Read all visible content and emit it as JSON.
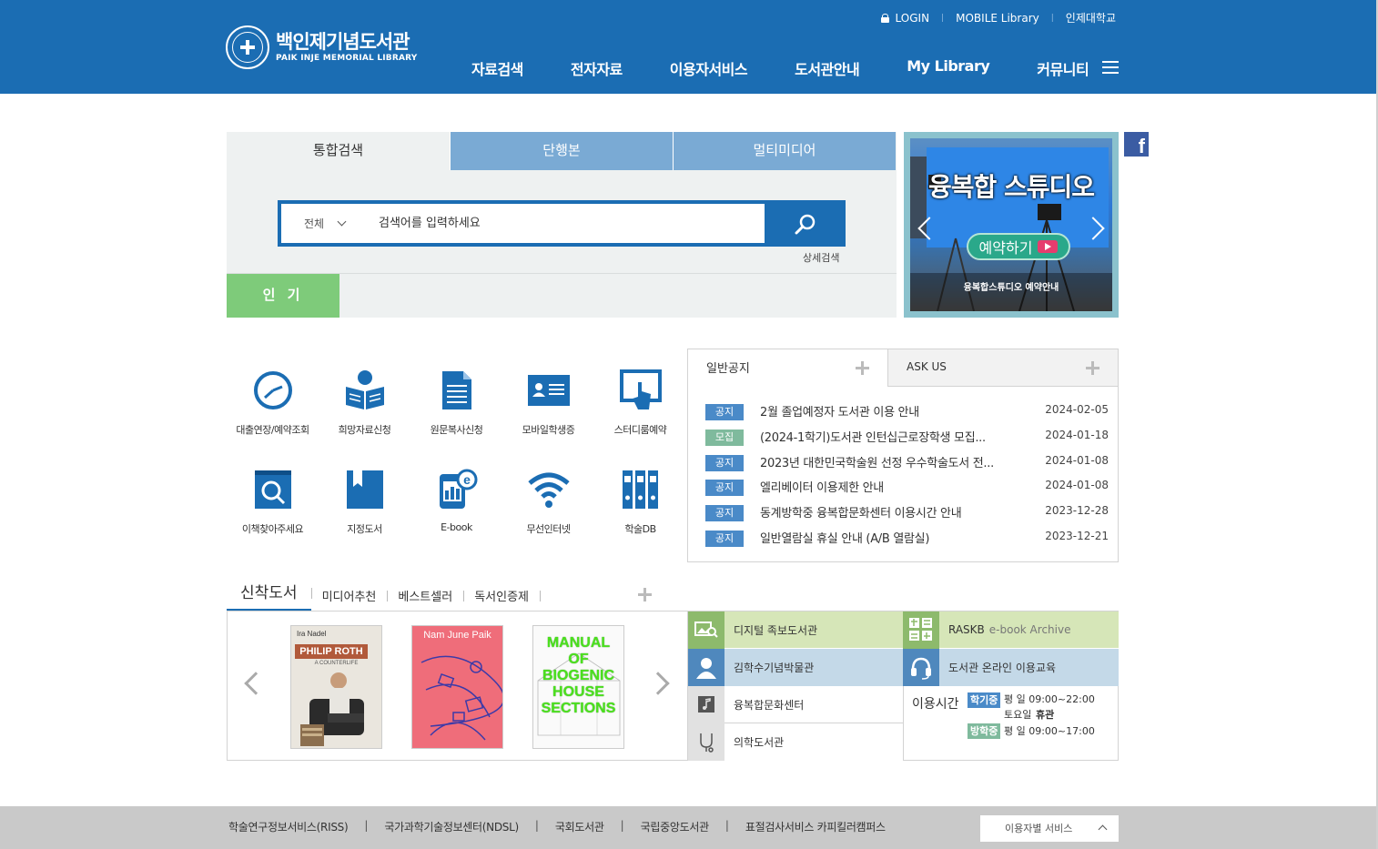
{
  "header": {
    "logo_ko": "백인제기념도서관",
    "logo_en": "PAIK INJE MEMORIAL LIBRARY",
    "util": {
      "login": "LOGIN",
      "mobile": "MOBILE Library",
      "univ": "인제대학교"
    },
    "nav": [
      "자료검색",
      "전자자료",
      "이용자서비스",
      "도서관안내",
      "My Library",
      "커뮤니티"
    ]
  },
  "search": {
    "tabs": [
      "통합검색",
      "단행본",
      "멀티미디어"
    ],
    "scope": "전체",
    "placeholder": "검색어를 입력하세요",
    "advanced": "상세검색",
    "popular": "인 기"
  },
  "banner": {
    "title": "융복합 스튜디오",
    "reserve": "예약하기",
    "caption": "융복합스튜디오 예약안내"
  },
  "quick_menu": [
    {
      "label": "대출연장/예약조회",
      "icon": "clock-icon"
    },
    {
      "label": "희망자료신청",
      "icon": "reader-icon"
    },
    {
      "label": "원문복사신청",
      "icon": "document-icon"
    },
    {
      "label": "모바일학생증",
      "icon": "id-card-icon"
    },
    {
      "label": "스터디룸예약",
      "icon": "touch-screen-icon"
    },
    {
      "label": "이책찾아주세요",
      "icon": "book-search-icon"
    },
    {
      "label": "지정도서",
      "icon": "bookmark-book-icon"
    },
    {
      "label": "E-book",
      "icon": "ebook-icon"
    },
    {
      "label": "무선인터넷",
      "icon": "wifi-icon"
    },
    {
      "label": "학술DB",
      "icon": "database-binders-icon"
    }
  ],
  "notice": {
    "tabs": [
      "일반공지",
      "ASK US"
    ],
    "items": [
      {
        "badge": "공지",
        "title": "2월 졸업예정자 도서관 이용 안내",
        "date": "2024-02-05"
      },
      {
        "badge": "모집",
        "title": "(2024-1학기)도서관 인턴십근로장학생 모집...",
        "date": "2024-01-18"
      },
      {
        "badge": "공지",
        "title": "2023년 대한민국학술원 선정 우수학술도서 전...",
        "date": "2024-01-08"
      },
      {
        "badge": "공지",
        "title": "엘리베이터 이용제한 안내",
        "date": "2024-01-08"
      },
      {
        "badge": "공지",
        "title": "동계방학중 융복합문화센터 이용시간 안내",
        "date": "2023-12-28"
      },
      {
        "badge": "공지",
        "title": "일반열람실 휴실 안내 (A/B 열람실)",
        "date": "2023-12-21"
      }
    ],
    "colors": {
      "notice": "#4a8ac8",
      "recruit": "#7fba9d"
    }
  },
  "books": {
    "tabs": [
      "신착도서",
      "미디어추천",
      "베스트셀러",
      "독서인증제"
    ],
    "covers": [
      {
        "author": "Ira Nadel",
        "title": "PHILIP ROTH",
        "subtitle": "A COUNTERLIFE"
      },
      {
        "author": "Nam June Paik",
        "title": ""
      },
      {
        "title": "MANUAL OF BIOGENIC HOUSE SECTIONS"
      }
    ]
  },
  "links": {
    "digital": "디지털 족보도서관",
    "raskb": "RASKB",
    "raskb_sub": "e-book Archive",
    "museum": "김학수기념박물관",
    "education": "도서관 온라인 이용교육",
    "culture": "융복합문화센터",
    "medical": "의학도서관",
    "hours": {
      "title": "이용시간",
      "semester_badge": "학기중",
      "weekday": "평     일  09:00~22:00",
      "saturday_label": "토요일",
      "saturday_value": "휴관",
      "vacation_badge": "방학중",
      "vacation_weekday": "평     일  09:00~17:00"
    }
  },
  "footer": {
    "links": [
      "학술연구정보서비스(RISS)",
      "국가과학기술정보센터(NDSL)",
      "국회도서관",
      "국립중앙도서관",
      "표절검사서비스 카피킬러캠퍼스"
    ],
    "select": "이용자별 서비스"
  },
  "colors": {
    "brand": "#1b6db3",
    "popular": "#7ecb7a"
  }
}
